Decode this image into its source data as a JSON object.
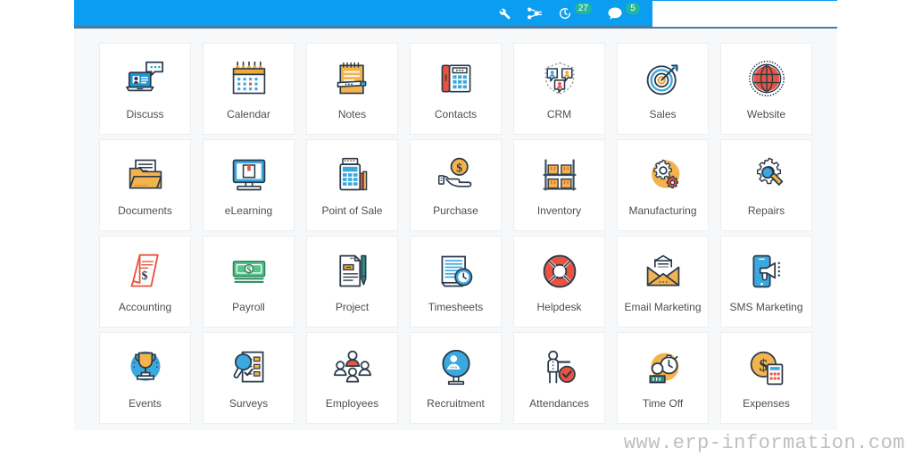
{
  "topbar": {
    "background_color": "#0b9df0",
    "border_color": "#4a7ba7",
    "badge_color": "#21b799",
    "icons": [
      {
        "name": "wrench-icon",
        "badge": null
      },
      {
        "name": "settings-nodes-icon",
        "badge": null
      },
      {
        "name": "activity-clock-icon",
        "badge": "27"
      },
      {
        "name": "chat-bubble-icon",
        "badge": "5"
      }
    ],
    "search": {
      "value": "",
      "placeholder": ""
    }
  },
  "apps": [
    {
      "label": "Discuss",
      "icon": "discuss-icon"
    },
    {
      "label": "Calendar",
      "icon": "calendar-icon"
    },
    {
      "label": "Notes",
      "icon": "notes-icon"
    },
    {
      "label": "Contacts",
      "icon": "contacts-icon"
    },
    {
      "label": "CRM",
      "icon": "crm-icon"
    },
    {
      "label": "Sales",
      "icon": "sales-icon"
    },
    {
      "label": "Website",
      "icon": "website-icon"
    },
    {
      "label": "Documents",
      "icon": "documents-icon"
    },
    {
      "label": "eLearning",
      "icon": "elearning-icon"
    },
    {
      "label": "Point of Sale",
      "icon": "point-of-sale-icon"
    },
    {
      "label": "Purchase",
      "icon": "purchase-icon"
    },
    {
      "label": "Inventory",
      "icon": "inventory-icon"
    },
    {
      "label": "Manufacturing",
      "icon": "manufacturing-icon"
    },
    {
      "label": "Repairs",
      "icon": "repairs-icon"
    },
    {
      "label": "Accounting",
      "icon": "accounting-icon"
    },
    {
      "label": "Payroll",
      "icon": "payroll-icon"
    },
    {
      "label": "Project",
      "icon": "project-icon"
    },
    {
      "label": "Timesheets",
      "icon": "timesheets-icon"
    },
    {
      "label": "Helpdesk",
      "icon": "helpdesk-icon"
    },
    {
      "label": "Email Marketing",
      "icon": "email-marketing-icon"
    },
    {
      "label": "SMS Marketing",
      "icon": "sms-marketing-icon"
    },
    {
      "label": "Events",
      "icon": "events-icon"
    },
    {
      "label": "Surveys",
      "icon": "surveys-icon"
    },
    {
      "label": "Employees",
      "icon": "employees-icon"
    },
    {
      "label": "Recruitment",
      "icon": "recruitment-icon"
    },
    {
      "label": "Attendances",
      "icon": "attendances-icon"
    },
    {
      "label": "Time Off",
      "icon": "time-off-icon"
    },
    {
      "label": "Expenses",
      "icon": "expenses-icon"
    }
  ],
  "watermark": "www.erp-information.com"
}
